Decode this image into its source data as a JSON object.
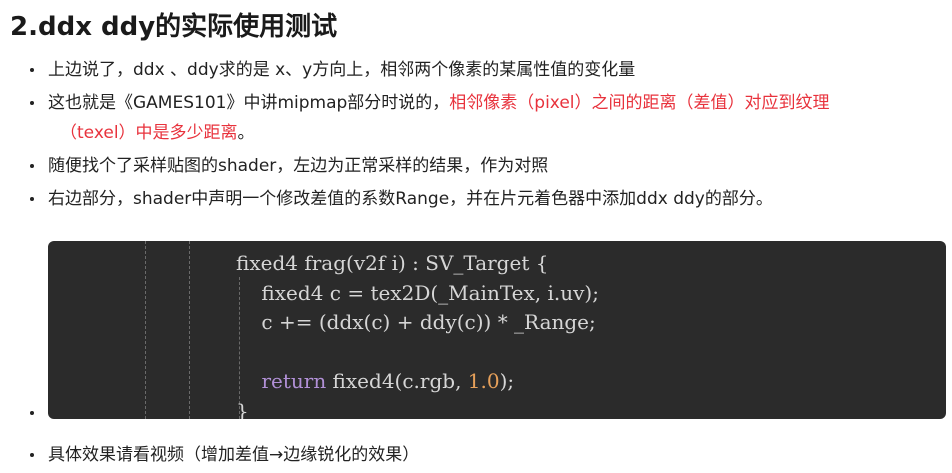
{
  "heading": "2.ddx ddy的实际使用测试",
  "bullets": [
    {
      "text": "上边说了，ddx 、ddy求的是 x、y方向上，相邻两个像素的某属性值的变化量"
    },
    {
      "prefix": "这也就是《GAMES101》中讲mipmap部分时说的，",
      "red_line1": "相邻像素（pixel）之间的距离（差值）对应到纹理",
      "red_line2": "（texel）中是多少距离",
      "suffix": "。"
    },
    {
      "text": "随便找个了采样贴图的shader，左边为正常采样的结果，作为对照"
    },
    {
      "text": "右边部分，shader中声明一个修改差值的系数Range，并在片元着色器中添加ddx ddy的部分。"
    }
  ],
  "code": {
    "line1": "fixed4 frag(v2f i) : SV_Target {",
    "line2": "    fixed4 c = tex2D(_MainTex, i.uv);",
    "line3": "    c += (ddx(c) + ddy(c)) * _Range;",
    "line4": "",
    "line5_kw": "return",
    "line5_mid": " fixed4(c.rgb, ",
    "line5_num": "1.0",
    "line5_end": ");",
    "line6": "}"
  },
  "last_bullet": "具体效果请看视频（增加差值→边缘锐化的效果）",
  "colors": {
    "accent_red": "#e8323c",
    "code_bg": "#2b2b2b",
    "keyword": "#b190d6",
    "number": "#e6a05a"
  }
}
